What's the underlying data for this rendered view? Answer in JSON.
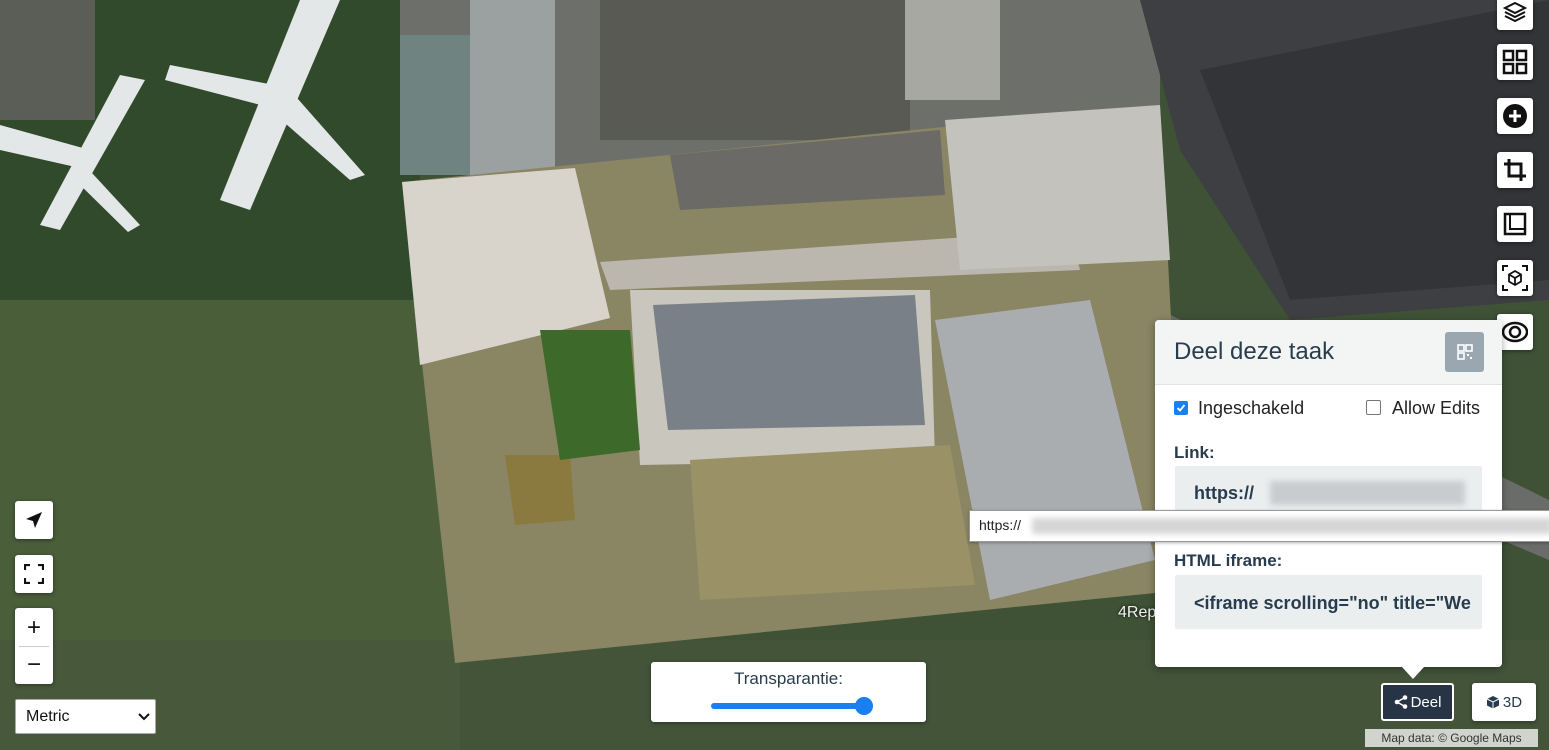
{
  "map": {
    "attribution": "Map data: © Google Maps",
    "watermark": "4Rep"
  },
  "controls": {
    "right": [
      "layers-icon",
      "grid-icon",
      "plus-circle-icon",
      "crop-icon",
      "ruler-icon",
      "cube-icon",
      "eye-icon"
    ],
    "left": {
      "zoom_in": "+",
      "zoom_out": "−",
      "units_value": "Metric",
      "units_options": [
        "Metric"
      ]
    }
  },
  "transparency": {
    "label": "Transparantie:",
    "value": 1.0
  },
  "share_panel": {
    "title": "Deel deze taak",
    "enabled_label": "Ingeschakeld",
    "enabled_checked": true,
    "allow_edits_label": "Allow Edits",
    "allow_edits_checked": false,
    "link_label": "Link:",
    "link_value": "https://",
    "iframe_label": "HTML iframe:",
    "iframe_value": "<iframe scrolling=\"no\" title=\"We"
  },
  "tooltip": {
    "text": "https://"
  },
  "bottom_buttons": {
    "share_label": "Deel",
    "threed_label": "3D"
  },
  "colors": {
    "accent": "#1a7ff0",
    "dark_button": "#263445",
    "panel_field": "#ebeeef"
  }
}
